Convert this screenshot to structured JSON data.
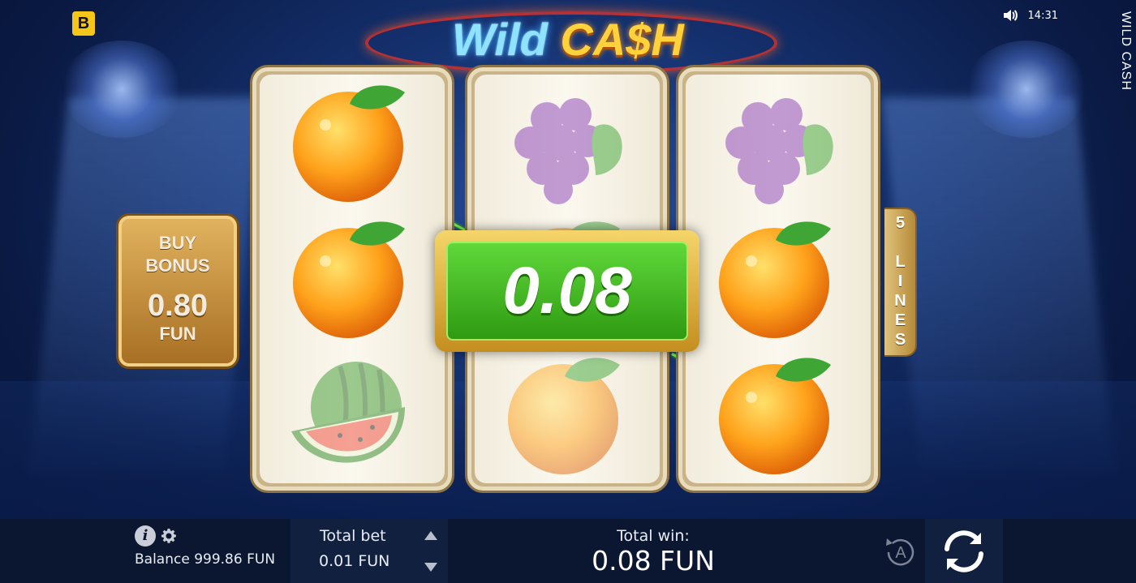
{
  "game": {
    "title": "WILD CASH",
    "brand_letter": "B"
  },
  "logo": {
    "word1": "Wild",
    "word2": "CA$H"
  },
  "status": {
    "time": "14:31",
    "sound_icon": "speaker-icon"
  },
  "buy_bonus": {
    "line1": "BUY",
    "line2": "BONUS",
    "value": "0.80",
    "currency": "FUN"
  },
  "lines_tab": {
    "label": "5 LINES"
  },
  "win_overlay": {
    "value": "0.08"
  },
  "reels": [
    [
      "orange",
      "orange",
      "watermelon"
    ],
    [
      "grapes",
      "orange",
      "orange"
    ],
    [
      "grapes",
      "orange",
      "orange"
    ]
  ],
  "bottom": {
    "balance": "Balance 999.86 FUN",
    "total_bet_label": "Total bet",
    "total_bet_value": "0.01 FUN",
    "total_win_label": "Total win:",
    "total_win_value": "0.08 FUN",
    "autoplay_letter": "A"
  },
  "colors": {
    "payline": "#7df04b",
    "gold": "#e2b460",
    "win_green": "#3fb61c"
  }
}
